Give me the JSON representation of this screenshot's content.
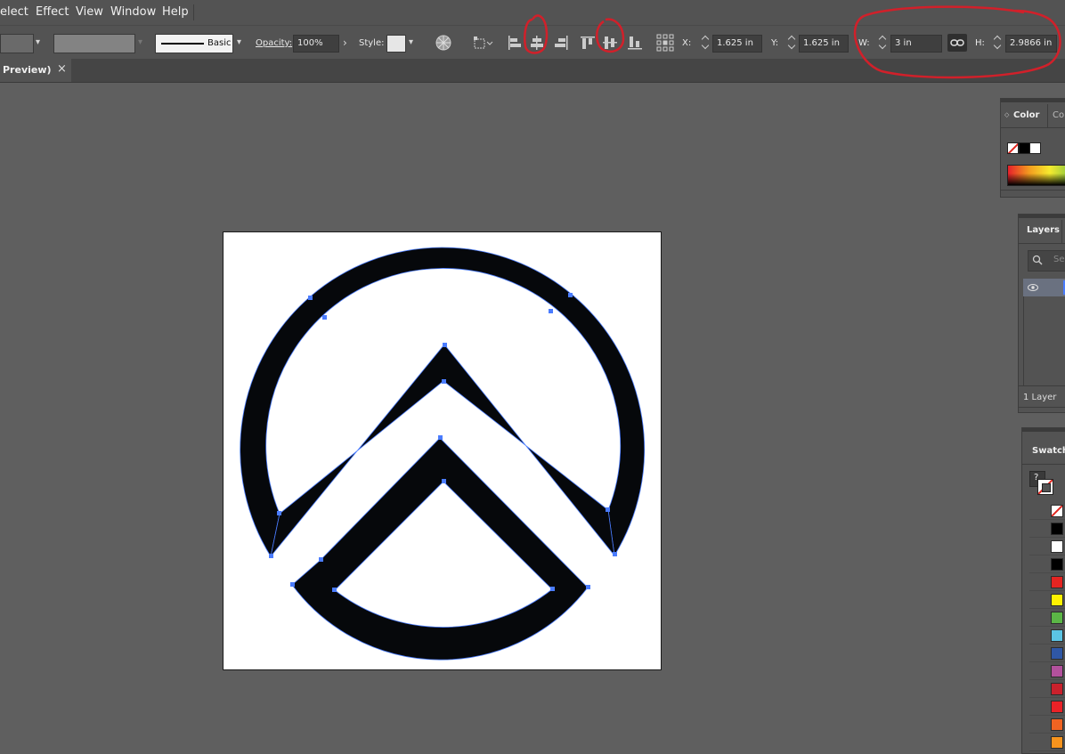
{
  "menu": {
    "items": [
      "elect",
      "Effect",
      "View",
      "Window",
      "Help"
    ]
  },
  "control_bar": {
    "stroke_style_label": "Basic",
    "opacity_label": "Opacity:",
    "opacity_value": "100%",
    "style_label": "Style:",
    "x_label": "X:",
    "x_value": "1.625 in",
    "y_label": "Y:",
    "y_value": "1.625 in",
    "w_label": "W:",
    "w_value": "3 in",
    "h_label": "H:",
    "h_value": "2.9866 in"
  },
  "document_tab": {
    "title": "Preview)",
    "close_glyph": "×"
  },
  "color_panel": {
    "tab_active": "Color",
    "tab_other": "Co",
    "tab_arrow": "◇"
  },
  "layers_panel": {
    "tab": "Layers",
    "search_placeholder": "Se",
    "footer": "1 Layer"
  },
  "swatches_panel": {
    "tab": "Swatche",
    "unknown_glyph": "?",
    "colors": [
      "none",
      "#000000",
      "#ffffff",
      "#000000",
      "#e52421",
      "#fff100",
      "#5bb646",
      "#5bc4e4",
      "#2f57a5",
      "#b2519d",
      "#c9212c",
      "#ea2227",
      "#f06322",
      "#f7931d"
    ]
  },
  "annotations": {
    "color": "#d1202a"
  },
  "colors": {
    "selection": "#4a7cff",
    "artwork": "#06080b"
  }
}
